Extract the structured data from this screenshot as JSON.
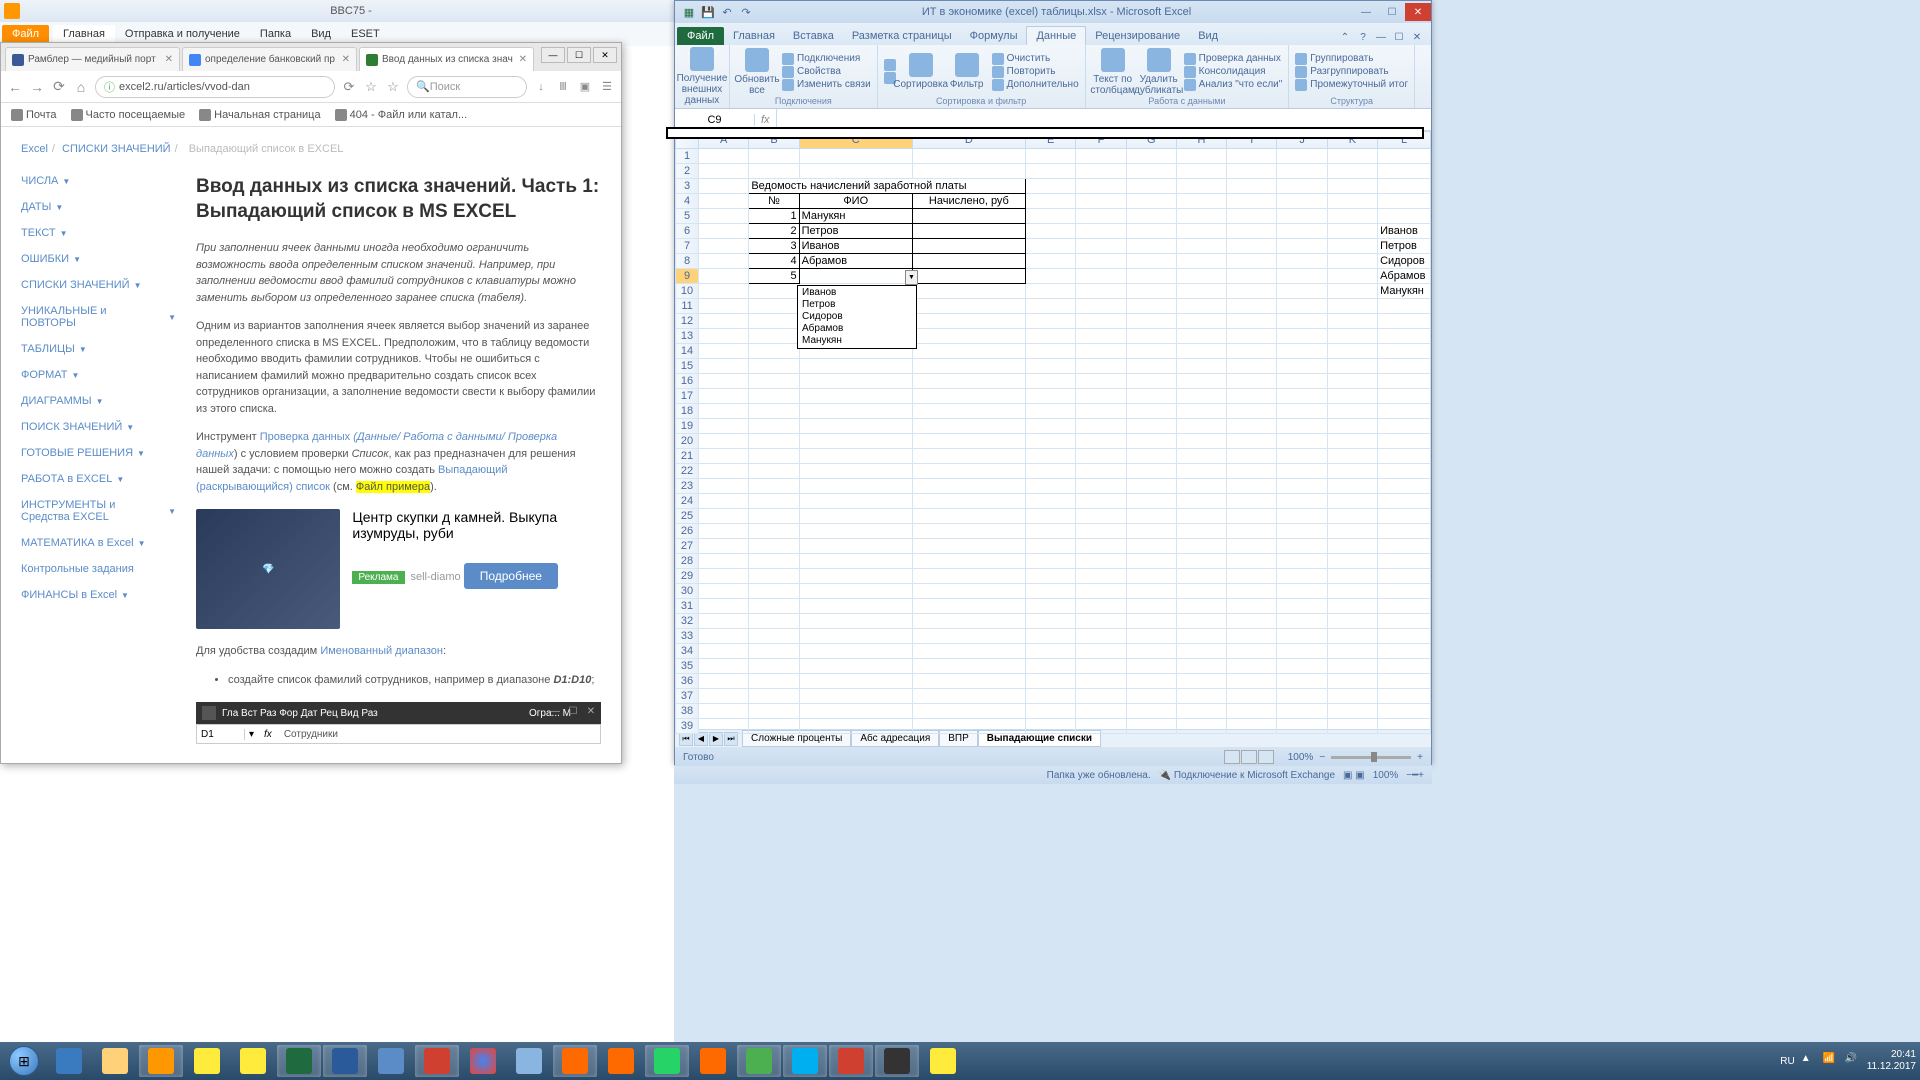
{
  "outlook": {
    "title": "BBC75 -",
    "tabs": {
      "file": "Файл",
      "items": [
        "Главная",
        "Отправка и получение",
        "Папка",
        "Вид",
        "ESET"
      ]
    }
  },
  "browser": {
    "tabs": [
      {
        "label": "Рамблер — медийный порт"
      },
      {
        "label": "определение банковский пр"
      },
      {
        "label": "Ввод данных из списка знач"
      }
    ],
    "url": "excel2.ru/articles/vvod-dan",
    "search_placeholder": "Поиск",
    "bookmarks": [
      "Почта",
      "Часто посещаемые",
      "Начальная страница",
      "404 - Файл или катал..."
    ],
    "breadcrumb": [
      "Excel",
      "СПИСКИ ЗНАЧЕНИЙ",
      "Выпадающий список в EXCEL"
    ],
    "side": [
      "ЧИСЛА",
      "ДАТЫ",
      "ТЕКСТ",
      "ОШИБКИ",
      "СПИСКИ ЗНАЧЕНИЙ",
      "УНИКАЛЬНЫЕ и ПОВТОРЫ",
      "ТАБЛИЦЫ",
      "ФОРМАТ",
      "ДИАГРАММЫ",
      "ПОИСК ЗНАЧЕНИЙ",
      "ГОТОВЫЕ РЕШЕНИЯ",
      "РАБОТА в EXCEL",
      "ИНСТРУМЕНТЫ и Средства EXCEL",
      "МАТЕМАТИКА в Excel",
      "Контрольные задания",
      "ФИНАНСЫ в Excel"
    ],
    "article": {
      "title": "Ввод данных из списка значений. Часть 1: Выпадающий список в MS EXCEL",
      "intro": "При заполнении ячеек данными иногда необходимо ограничить возможность ввода определенным списком значений. Например, при заполнении ведомости ввод фамилий сотрудников с клавиатуры можно заменить выбором из определенного заранее списка (табеля).",
      "p2": "Одним из вариантов заполнения ячеек является выбор значений из заранее определенного списка в MS EXCEL. Предположим, что в таблицу ведомости необходимо вводить фамилии сотрудников. Чтобы не ошибиться с написанием фамилий можно предварительно создать список всех сотрудников организации, а заполнение ведомости свести к выбору фамилии из этого списка.",
      "p3_a": "Инструмент ",
      "p3_link1": "Проверка данных",
      "p3_link2": " (Данные/ Работа с данными/ Проверка данных",
      "p3_b": ") с условием проверки ",
      "p3_i": "Список",
      "p3_c": ", как раз предназначен для решения нашей задачи: с помощью него можно создать ",
      "p3_link3": "Выпадающий (раскрывающийся) список",
      "p3_d": " (см. ",
      "p3_hl": "Файл примера",
      "p3_e": ").",
      "ad": {
        "title": "Центр скупки д камней. Выкупа изумруды, руби",
        "tag": "Реклама",
        "domain": "sell-diamo",
        "btn": "Подробнее"
      },
      "p4_a": "Для удобства создадим ",
      "p4_link": "Именованный диапазон",
      "p4_b": ":",
      "li": "создайте список фамилий сотрудников, например в диапазоне ",
      "li_b": "D1:D10",
      "nested_title": "Огра... М",
      "nested_cell": "D1",
      "nested_val": "Сотрудники"
    }
  },
  "excel": {
    "title": "ИТ в экономике (excel) таблицы.xlsx - Microsoft Excel",
    "tabs": {
      "file": "Файл",
      "items": [
        "Главная",
        "Вставка",
        "Разметка страницы",
        "Формулы",
        "Данные",
        "Рецензирование",
        "Вид"
      ],
      "active": "Данные"
    },
    "ribbon": {
      "g1": {
        "l": "Получение внешних данных",
        "big": "Получение внешних данных"
      },
      "g2": {
        "l": "Подключения",
        "big": "Обновить все",
        "items": [
          "Подключения",
          "Свойства",
          "Изменить связи"
        ]
      },
      "g3": {
        "l": "Сортировка и фильтр",
        "b1": "A↓Z",
        "s": "Сортировка",
        "f": "Фильтр",
        "items": [
          "Очистить",
          "Повторить",
          "Дополнительно"
        ]
      },
      "g4": {
        "l": "Работа с данными",
        "b1": "Текст по столбцам",
        "b2": "Удалить дубликаты",
        "items": [
          "Проверка данных",
          "Консолидация",
          "Анализ \"что если\""
        ]
      },
      "g5": {
        "l": "Структура",
        "items": [
          "Группировать",
          "Разгруппировать",
          "Промежуточный итог"
        ]
      }
    },
    "cell_name": "C9",
    "cols": [
      "A",
      "B",
      "C",
      "D",
      "E",
      "F",
      "G",
      "H",
      "I",
      "J",
      "K",
      "L"
    ],
    "data": {
      "B3": "Ведомость начислений заработной платы",
      "B4": "№",
      "C4": "ФИО",
      "D4": "Начислено, руб",
      "B5": "1",
      "C5": "Манукян",
      "B6": "2",
      "C6": "Петров",
      "B7": "3",
      "C7": "Иванов",
      "B8": "4",
      "C8": "Абрамов",
      "B9": "5",
      "L6": "Иванов",
      "L7": "Петров",
      "L8": "Сидоров",
      "L9": "Абрамов",
      "L10": "Манукян"
    },
    "dropdown": [
      "Иванов",
      "Петров",
      "Сидоров",
      "Абрамов",
      "Манукян"
    ],
    "sheets": [
      "Сложные проценты",
      "Абс адресация",
      "ВПР",
      "Выпадающие списки"
    ],
    "active_sheet": "Выпадающие списки",
    "status": "Готово",
    "zoom": "100%"
  },
  "ostatus": {
    "left": "Папка уже обновлена.",
    "mid": "Подключение к Microsoft Exchange",
    "zoom": "100%"
  },
  "taskbar": {
    "apps": [
      "ie",
      "explorer",
      "outlook",
      "1c",
      "word",
      "excel",
      "word2",
      "pp",
      "pp2",
      "chrome",
      "paint",
      "ff",
      "ff2",
      "wa",
      "sk",
      "ut",
      "sk2",
      "pdf",
      "cmd",
      "1c2"
    ],
    "lang": "RU",
    "time": "20:41",
    "date": "11.12.2017"
  },
  "chart_data": null
}
